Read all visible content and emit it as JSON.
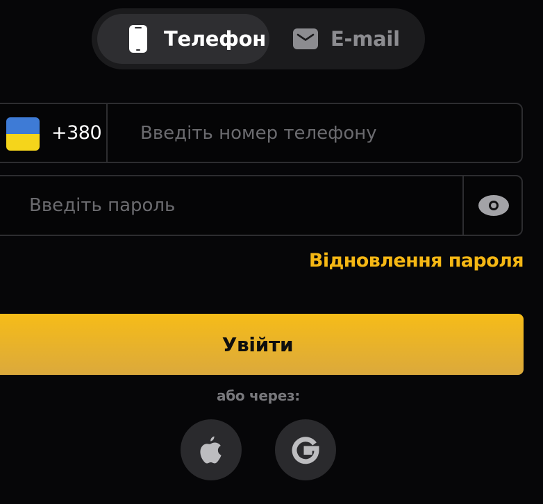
{
  "tabs": {
    "phone": {
      "label": "Телефон",
      "icon": "phone-icon",
      "active": true
    },
    "email": {
      "label": "E-mail",
      "icon": "mail-icon",
      "active": false
    }
  },
  "phone_field": {
    "country_flag": "ukraine-flag",
    "dial_code": "+380",
    "value": "",
    "placeholder": "Введіть номер телефону"
  },
  "password_field": {
    "value": "",
    "placeholder": "Введіть пароль",
    "toggle_icon": "eye-icon"
  },
  "forgot_password": {
    "label": "Відновлення пароля"
  },
  "login_button": {
    "label": "Увійти"
  },
  "social": {
    "label": "або через:",
    "providers": [
      {
        "icon": "apple-icon"
      },
      {
        "icon": "google-icon"
      }
    ]
  },
  "colors": {
    "background": "#060608",
    "accent": "#f5b714",
    "button_top": "#f6bc18",
    "button_bottom": "#dba93c",
    "tab_bar": "#1b1b1d",
    "tab_active": "#2e2e31",
    "border": "#2d2d30",
    "flag_blue": "#3e7bd6",
    "flag_yellow": "#f5d51b"
  }
}
